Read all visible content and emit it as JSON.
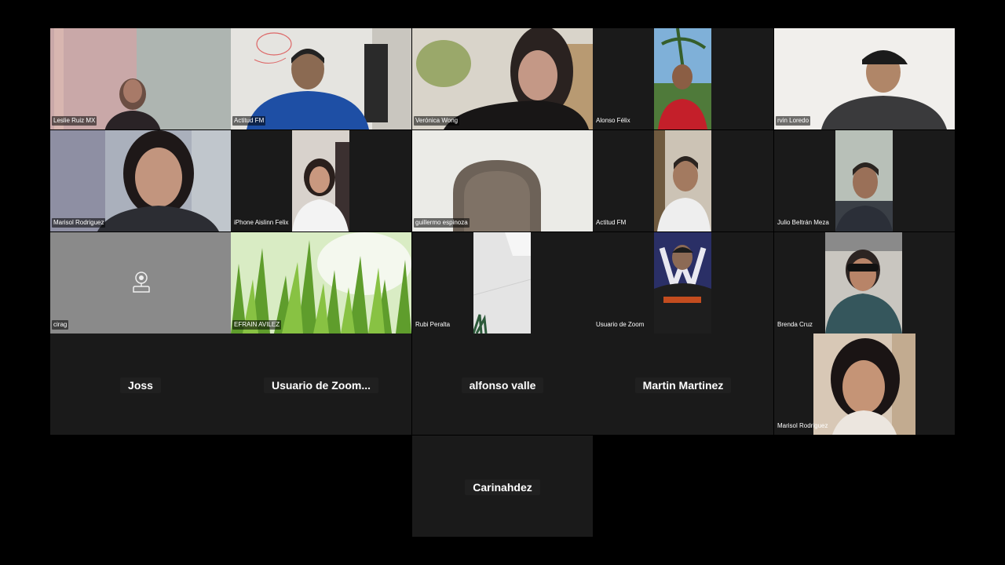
{
  "participants": {
    "p1": {
      "name": "Leslie Ruiz MX"
    },
    "p2": {
      "name": "Actitud FM"
    },
    "p3": {
      "name": "Verónica Wong"
    },
    "p4": {
      "name": "Alonso Félix"
    },
    "p5": {
      "name": "rvin Loredo"
    },
    "p6": {
      "name": "Marisol Rodriguez"
    },
    "p7": {
      "name": "iPhone Aislinn Felix"
    },
    "p8": {
      "name": "guillermo espinoza"
    },
    "p9": {
      "name": "Actitud FM"
    },
    "p10": {
      "name": "Julio Beltrán Meza"
    },
    "p11": {
      "name": "cirag",
      "icon": "camera-off-icon"
    },
    "p12": {
      "name": "EFRAIN AVILEZ"
    },
    "p13": {
      "name": "Rubi Peralta"
    },
    "p14": {
      "name": "Usuario de Zoom"
    },
    "p15": {
      "name": "Brenda Cruz"
    },
    "p16": {
      "name": "Joss"
    },
    "p17": {
      "name": "Usuario de Zoom..."
    },
    "p18": {
      "name": "alfonso valle"
    },
    "p19": {
      "name": "Martin Martinez"
    },
    "p20": {
      "name": "Marisol Rodriguez"
    },
    "p21": {
      "name": "Carinahdez"
    }
  },
  "colors": {
    "tile_bg": "#1a1a1a",
    "no_video_bg": "#888888",
    "label_text": "#ffffff"
  }
}
